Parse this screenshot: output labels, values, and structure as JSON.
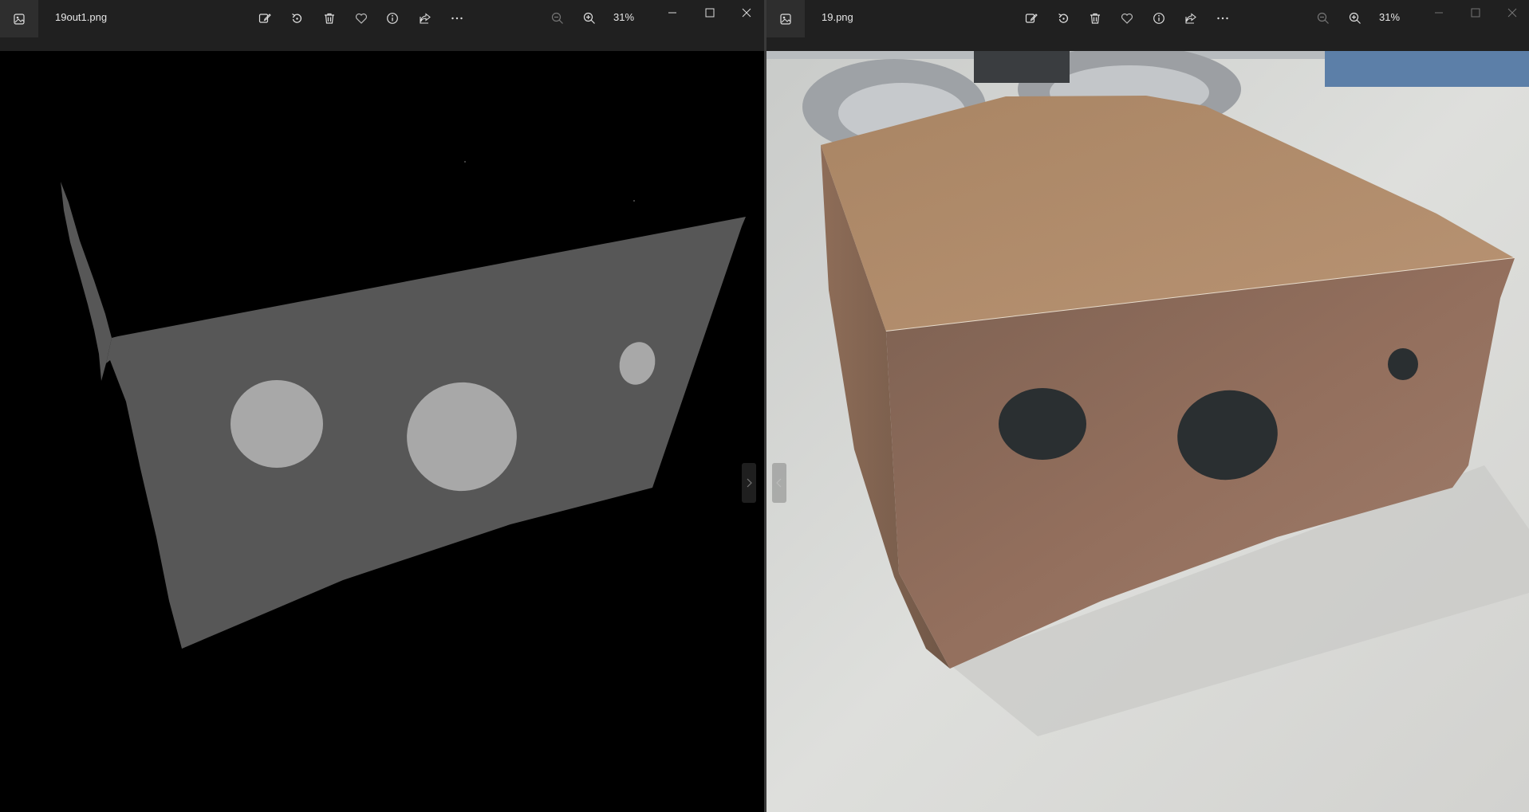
{
  "left_window": {
    "filename": "19out1.png",
    "zoom": "31%",
    "toolbar_icons": [
      "edit-image-icon",
      "rotate-icon",
      "delete-icon",
      "favorite-icon",
      "info-icon",
      "share-icon",
      "more-icon"
    ],
    "window_controls": [
      "minimize-icon",
      "maximize-icon",
      "close-icon"
    ]
  },
  "right_window": {
    "filename": "19.png",
    "zoom": "31%",
    "toolbar_icons": [
      "edit-image-icon",
      "rotate-icon",
      "delete-icon",
      "favorite-icon",
      "info-icon",
      "share-icon",
      "more-icon"
    ],
    "window_controls": [
      "minimize-icon",
      "maximize-icon",
      "close-icon"
    ]
  },
  "colors": {
    "titlebar": "#202020",
    "mask_background": "#000000",
    "mask_surface": "#575757",
    "mask_holes": "#a8a8a8",
    "box_front": "#8a6d5e",
    "box_top": "#b08b69",
    "box_dots": "#2a2f31",
    "table": "#d9d9d6"
  }
}
